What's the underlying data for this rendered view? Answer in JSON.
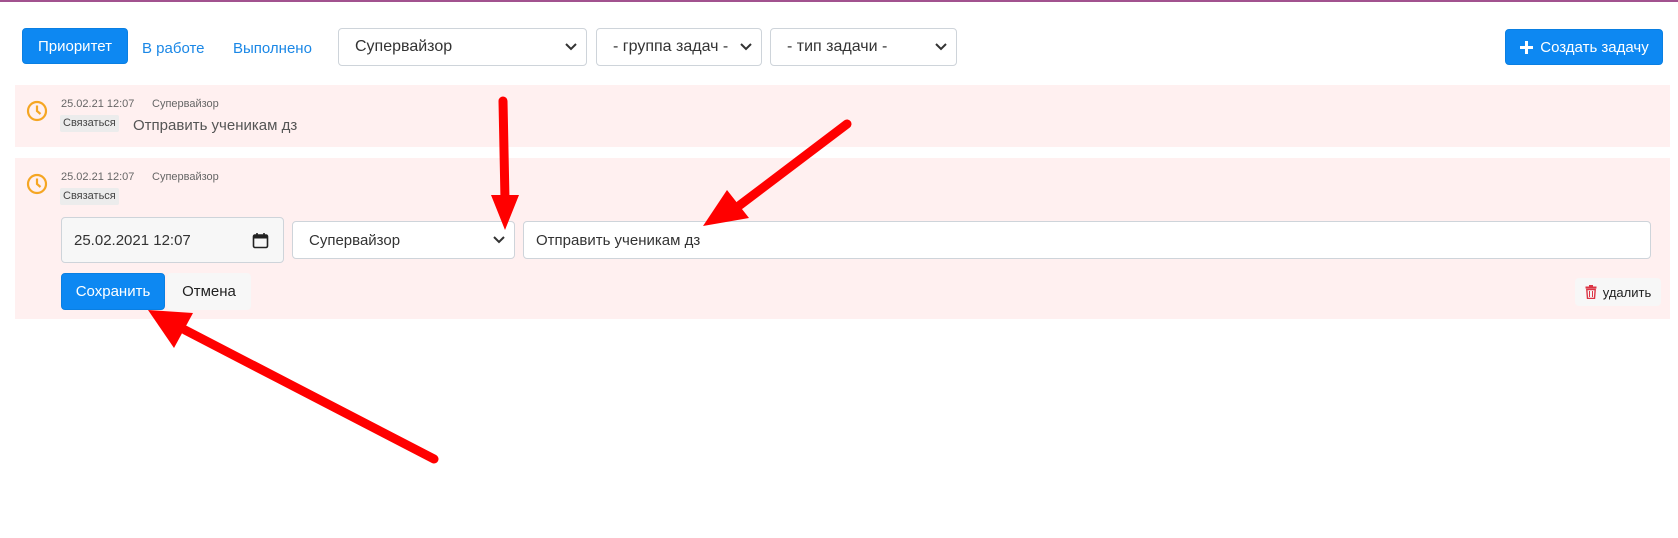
{
  "toolbar": {
    "tab_priority": "Приоритет",
    "tab_in_progress": "В работе",
    "tab_done": "Выполнено",
    "select_user": "Супервайзор",
    "select_group": "- группа задач -",
    "select_type": "- тип задачи -",
    "create_label": "Создать задачу"
  },
  "tasks": [
    {
      "date": "25.02.21 12:07",
      "user": "Супервайзор",
      "tag": "Связаться",
      "text": "Отправить ученикам дз"
    },
    {
      "date": "25.02.21 12:07",
      "user": "Супервайзор",
      "tag": "Связаться"
    }
  ],
  "editor": {
    "datetime_value": "25.02.2021 12:07",
    "user_select": "Супервайзор",
    "text_value": "Отправить ученикам дз",
    "save_label": "Сохранить",
    "cancel_label": "Отмена",
    "delete_label": "удалить"
  },
  "colors": {
    "primary": "#0d88f2",
    "row_bg": "#fff0f0",
    "clock": "#f5a623",
    "annotation_arrow": "#ff0000"
  }
}
